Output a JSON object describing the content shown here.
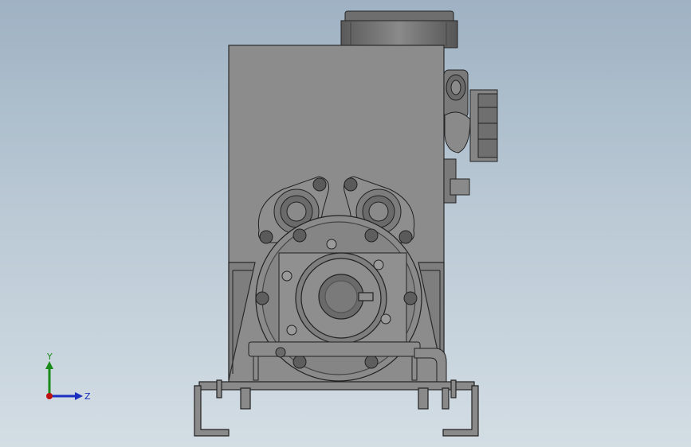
{
  "triad": {
    "y_label": "Y",
    "z_label": "Z",
    "colors": {
      "y": "#1a8a1a",
      "z": "#1a2fbf",
      "x": "#c01010"
    }
  },
  "colors": {
    "background_top": "#9fb2c3",
    "background_bottom": "#d3dde4",
    "body": "#8a8a8a",
    "stroke": "#2a2a2a"
  }
}
